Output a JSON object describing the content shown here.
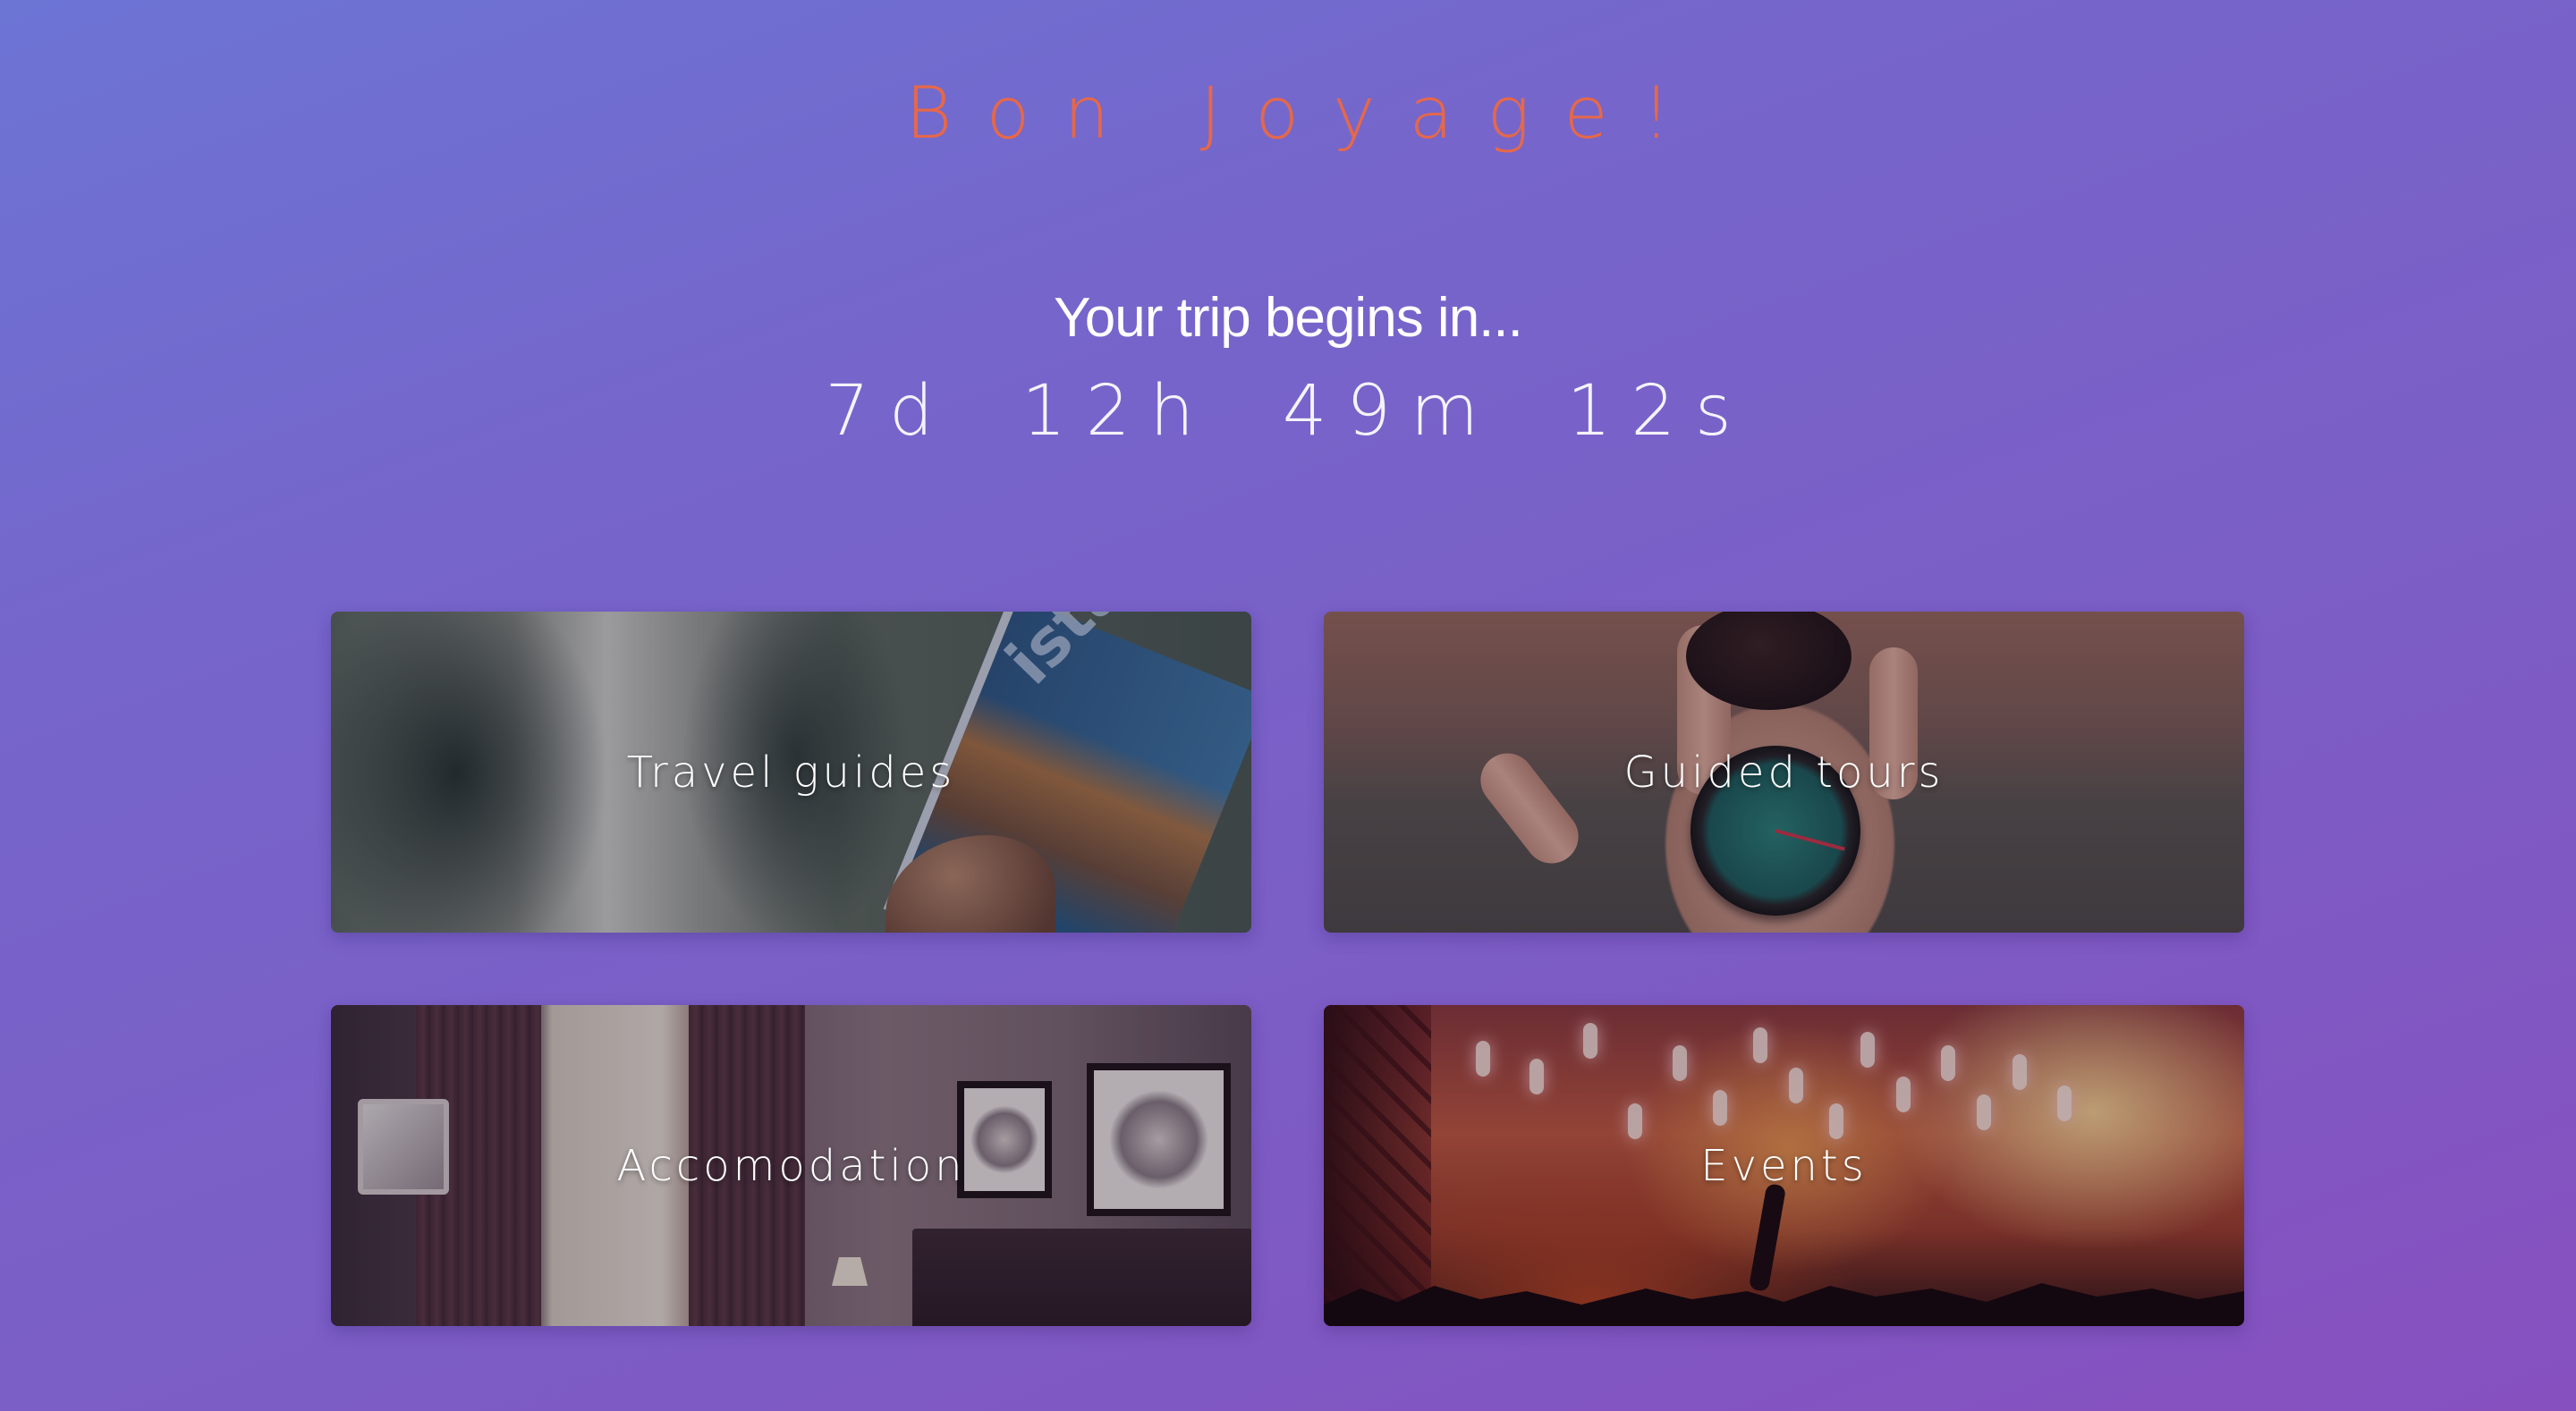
{
  "header": {
    "brand": "Bon Joyage!",
    "subtitle": "Your trip begins in..."
  },
  "countdown": {
    "days": "7d",
    "hours": "12h",
    "minutes": "49m",
    "seconds": "12s"
  },
  "cards": [
    {
      "label": "Travel guides",
      "image": "istanbul-guidebook-photo"
    },
    {
      "label": "Guided tours",
      "image": "compass-in-hand-photo"
    },
    {
      "label": "Accomodation",
      "image": "hotel-room-photo"
    },
    {
      "label": "Events",
      "image": "concert-crowd-photo"
    }
  ],
  "colors": {
    "brand": "#e5684a",
    "background_start": "#6c74d4",
    "background_end": "#8750bf",
    "text": "#ffffff"
  }
}
